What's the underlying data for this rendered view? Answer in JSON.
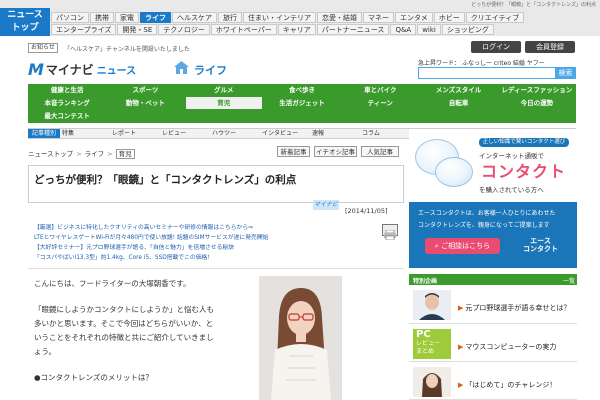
{
  "header": {
    "logo_line1": "ニュース",
    "logo_line2": "トップ",
    "tagline": "どっちが便利？「眼鏡」と「コンタクトレンズ」の利点",
    "nav_row1": [
      {
        "label": "パソコン",
        "active": false
      },
      {
        "label": "携帯",
        "active": false
      },
      {
        "label": "家電",
        "active": false
      },
      {
        "label": "ライフ",
        "active": true
      },
      {
        "label": "ヘルスケア",
        "active": false
      },
      {
        "label": "旅行",
        "active": false
      },
      {
        "label": "住まい・インテリア",
        "active": false
      },
      {
        "label": "恋愛・結婚",
        "active": false
      },
      {
        "label": "マネー",
        "active": false
      },
      {
        "label": "エンタメ",
        "active": false
      },
      {
        "label": "ホビー",
        "active": false
      },
      {
        "label": "クリエイティブ",
        "active": false
      }
    ],
    "nav_row2": [
      {
        "label": "エンタープライズ"
      },
      {
        "label": "開発・SE"
      },
      {
        "label": "テクノロジー"
      },
      {
        "label": "ホワイトペーパー"
      },
      {
        "label": "キャリア"
      },
      {
        "label": "パートナーニュース"
      },
      {
        "label": "Q&A"
      },
      {
        "label": "wiki"
      },
      {
        "label": "ショッピング"
      }
    ]
  },
  "notice": {
    "badge": "お知らせ",
    "text": "「ヘルスケア」チャンネルを開設いたしました"
  },
  "account": {
    "login": "ログイン",
    "register": "会員登録"
  },
  "brand": {
    "mark": "M",
    "name": "マイナビ",
    "section": "ニュース",
    "channel": "ライフ"
  },
  "search": {
    "hot_label": "急上昇ワード",
    "hot_words": "ふなっしー criteo 結婚 ヤフー",
    "placeholder": "",
    "button": "検索"
  },
  "categories": [
    {
      "label": "健康と生活",
      "active": false
    },
    {
      "label": "スポーツ",
      "active": false
    },
    {
      "label": "グルメ",
      "active": false
    },
    {
      "label": "食べ歩き",
      "active": false
    },
    {
      "label": "車とバイク",
      "active": false
    },
    {
      "label": "メンズスタイル",
      "active": false
    },
    {
      "label": "レディースファッション",
      "active": false
    },
    {
      "label": "本音ランキング",
      "active": false
    },
    {
      "label": "動物・ペット",
      "active": false
    },
    {
      "label": "育児",
      "active": true
    },
    {
      "label": "生活ガジェット",
      "active": false
    },
    {
      "label": "ティーン",
      "active": false
    },
    {
      "label": "自転車",
      "active": false
    },
    {
      "label": "今日の運勢",
      "active": false
    },
    {
      "label": "最大コンテスト",
      "active": false
    }
  ],
  "subtabs": {
    "label": "記事種別",
    "items": [
      "特集",
      "レポート",
      "レビュー",
      "ハウツー",
      "インタビュー",
      "速報",
      "コラム"
    ]
  },
  "breadcrumb": {
    "items": [
      "ニューストップ",
      "ライフ"
    ],
    "current": "育児",
    "sep": ">"
  },
  "article_actions": [
    "新着記事",
    "イチオシ記事",
    "人気記事"
  ],
  "article": {
    "title": "どっちが便利？「眼鏡」と「コンタクトレンズ」の利点",
    "date": "[2014/11/05]",
    "source_logo": "マイナビ",
    "promos": [
      "【厳選】ビジネスに特化したクオリティの高いセミナーや研修の情報はこちらから⇒",
      "LTEとワイヤレスゲートWi-Fiが月々480円で使い放題! 話題のSIMサービスが遂に発売開始",
      "【大好評セミナー】元プロ野球選手が語る、「自信と魅力」を倍増させる秘訣",
      "「コスパやばいi13.3型」約1.4kg、Core i5、SSD搭載でこの価格！"
    ],
    "paragraphs": [
      "こんにちは、フードライターの大塚朝香です。",
      "「眼鏡にしようかコンタクトにしようか」と悩む人も",
      "多いかと思います。そこで今回はどちらがいいか、と",
      "いうことをそれぞれの特徴と共にご紹介していきまし",
      "ょう。",
      "●コンタクトレンズのメリットは？"
    ]
  },
  "ad": {
    "caption": "正しい知識で賢いコンタクト選び",
    "line1": "インターネット通販で",
    "big": "コンタクト",
    "line2": "を購入されている方へ",
    "body1": "エースコンタクトは、お客様一人ひとりにあわせた",
    "body2": "コンタクトレンズを、親身になってご提案します",
    "button": "ご相談はこちら",
    "logo_line1": "エース",
    "logo_line2": "コンタクト"
  },
  "sidebar": {
    "heading": "特別企画",
    "list_link": "一覧",
    "items": [
      {
        "text": "元プロ野球選手が語る幸せとは？"
      },
      {
        "text": "マウスコンピューターの実力",
        "thumb_label_top": "PC",
        "thumb_label_mid": "レビュー",
        "thumb_label_bot": "まとめ"
      },
      {
        "text": "「はじめて」のチャレンジ！"
      }
    ]
  },
  "colors": {
    "brand_blue": "#1b7ac8",
    "category_green": "#3a9a2c",
    "ad_blue": "#1a76b8",
    "ad_pink": "#e94c70"
  }
}
